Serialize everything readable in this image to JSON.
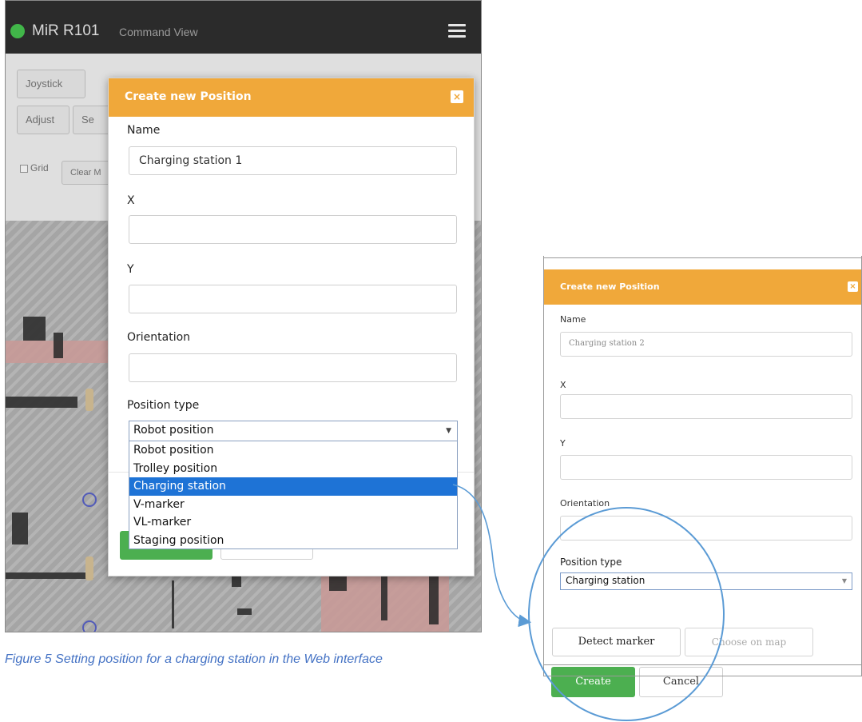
{
  "app": {
    "robot_name": "MiR R101",
    "view_name": "Command View"
  },
  "background_toolbar": {
    "joystick": "Joystick",
    "adjust": "Adjust",
    "set_partial": "Se",
    "grid": "Grid",
    "clear_partial": "Clear M"
  },
  "modal1": {
    "title": "Create new Position",
    "name_label": "Name",
    "name_value": "Charging station 1",
    "x_label": "X",
    "x_value": "",
    "y_label": "Y",
    "y_value": "",
    "orientation_label": "Orientation",
    "orientation_value": "",
    "position_type_label": "Position type",
    "position_type_selected": "Robot position",
    "position_type_options": [
      "Robot position",
      "Trolley position",
      "Charging station",
      "V-marker",
      "VL-marker",
      "Staging position"
    ],
    "highlighted_option": "Charging station"
  },
  "caption": "Figure 5 Setting position for a charging station in the Web interface",
  "modal2": {
    "title": "Create new Position",
    "name_label": "Name",
    "name_value": "Charging station 2",
    "x_label": "X",
    "y_label": "Y",
    "orientation_label": "Orientation",
    "position_type_label": "Position type",
    "position_type_selected": "Charging station",
    "detect_marker": "Detect marker",
    "choose_on_map": "Choose on map",
    "create": "Create",
    "cancel": "Cancel"
  },
  "colors": {
    "header_orange": "#f0a83a",
    "create_green": "#4caf50",
    "selection_blue": "#1e73d6",
    "annotation_blue": "#5b9bd5",
    "caption_blue": "#4472c4",
    "status_green": "#41b649"
  }
}
